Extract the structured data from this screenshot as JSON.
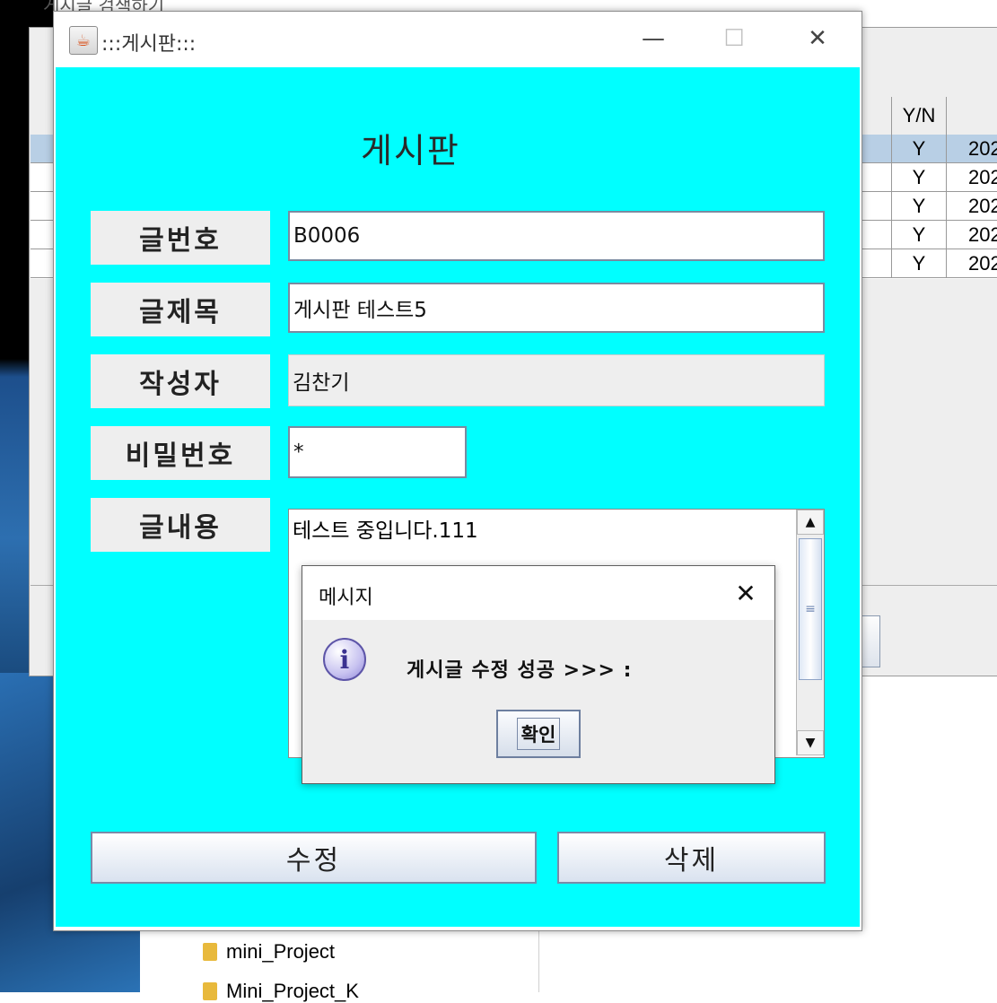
{
  "background": {
    "back_window_title": "게시글 검색하기",
    "back_table": {
      "yn_header": "Y/N",
      "rows": [
        {
          "dot": ".",
          "yn": "Y",
          "date": "202"
        },
        {
          "dot": ".",
          "yn": "Y",
          "date": "202"
        },
        {
          "dot": ".",
          "yn": "Y",
          "date": "202"
        },
        {
          "dot": ".",
          "yn": "Y",
          "date": "202"
        },
        {
          "dot": ".",
          "yn": "Y",
          "date": "202"
        }
      ]
    },
    "explorer": {
      "items": [
        "mini_Project",
        "Mini_Project_K"
      ]
    }
  },
  "window": {
    "title": ":::게시판:::",
    "minimize": "—",
    "maximize": "☐",
    "close": "✕"
  },
  "form": {
    "heading": "게시판",
    "number_label": "글번호",
    "number_value": "B0006",
    "title_label": "글제목",
    "title_value": "게시판 테스트5",
    "author_label": "작성자",
    "author_value": "김찬기",
    "password_label": "비밀번호",
    "password_value": "*",
    "content_label": "글내용",
    "content_value": "테스트 중입니다.111",
    "edit_button": "수정",
    "delete_button": "삭제"
  },
  "message": {
    "title": "메시지",
    "close": "✕",
    "icon_glyph": "i",
    "text": "게시글 수정 성공 >>> :",
    "ok_button": "확인"
  },
  "colors": {
    "content_background": "#00FFFF",
    "selected_row": "#B8CFE5"
  }
}
